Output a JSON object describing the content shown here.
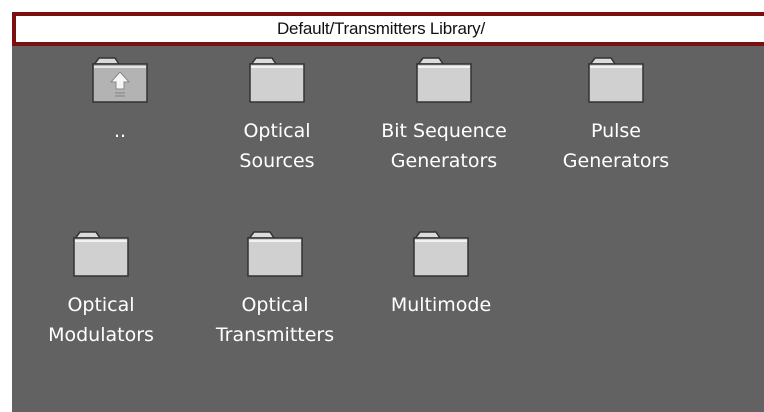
{
  "path_bar": {
    "path": "Default/Transmitters Library/"
  },
  "folders": [
    {
      "label": "..",
      "icon": "folder-up-icon"
    },
    {
      "label": "Optical\nSources",
      "icon": "folder-icon"
    },
    {
      "label": "Bit Sequence\nGenerators",
      "icon": "folder-icon"
    },
    {
      "label": "Pulse\nGenerators",
      "icon": "folder-icon"
    },
    {
      "label": "Optical\nModulators",
      "icon": "folder-icon"
    },
    {
      "label": "Optical\nTransmitters",
      "icon": "folder-icon"
    },
    {
      "label": "Multimode",
      "icon": "folder-icon"
    }
  ],
  "colors": {
    "panel_background": "#626262",
    "path_bar_border": "#7b1010",
    "label_text": "#ffffff"
  }
}
